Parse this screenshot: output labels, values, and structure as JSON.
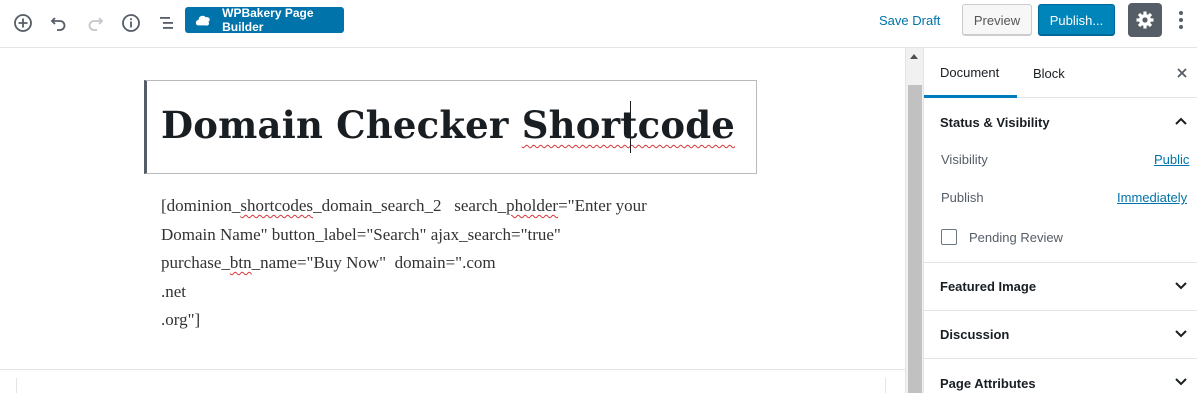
{
  "toolbar": {
    "icons": [
      "add-block-icon",
      "undo-icon",
      "redo-icon",
      "info-icon",
      "block-navigation-icon"
    ],
    "wpbakery_label": "WPBakery Page Builder",
    "save_draft_label": "Save Draft",
    "preview_label": "Preview",
    "publish_label": "Publish...",
    "settings_icon": "gear-icon",
    "more_icon": "more-vertical-icon"
  },
  "editor": {
    "title_plain": "Domain Checker ",
    "title_misspelled": "Shortcode",
    "paragraph": {
      "line1_a": "[dominion_",
      "line1_b": "shortcodes",
      "line1_c": "_domain_search_2   search_",
      "line1_d": "pholder",
      "line1_e": "=\"Enter your",
      "line2": "Domain Name\" button_label=\"Search\" ajax_search=\"true\"",
      "line3_a": "purchase_",
      "line3_b": "btn",
      "line3_c": "_name=\"Buy Now\"  domain=\".com",
      "line4": ".net",
      "line5": ".org\"]"
    }
  },
  "sidebar": {
    "tabs": [
      {
        "label": "Document",
        "active": true
      },
      {
        "label": "Block",
        "active": false
      }
    ],
    "close_icon": "close-icon",
    "status_visibility": {
      "title": "Status & Visibility",
      "expanded": true,
      "visibility_label": "Visibility",
      "visibility_value": "Public",
      "publish_label": "Publish",
      "publish_value": "Immediately",
      "pending_review_label": "Pending Review",
      "pending_review_checked": false
    },
    "panels": [
      {
        "title": "Featured Image",
        "expanded": false
      },
      {
        "title": "Discussion",
        "expanded": false
      },
      {
        "title": "Page Attributes",
        "expanded": false
      }
    ]
  },
  "colors": {
    "accent": "#0073aa",
    "publish": "#0085ba",
    "spellcheck": "#d63638",
    "tab_active": "#007cba"
  }
}
